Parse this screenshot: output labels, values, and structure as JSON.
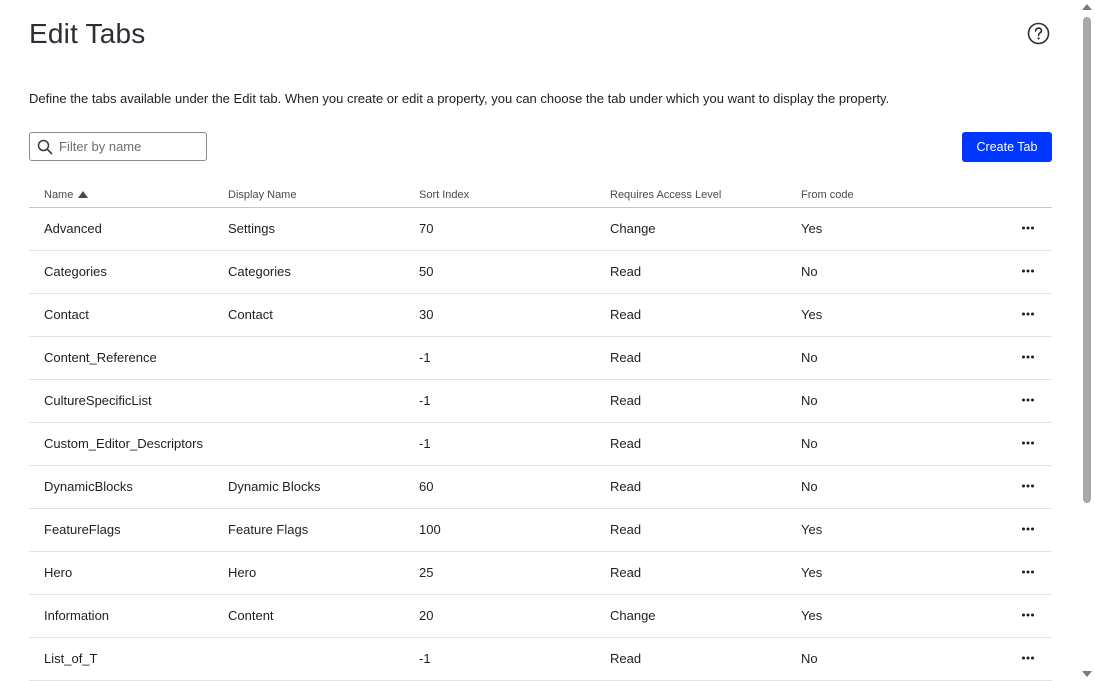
{
  "page": {
    "title": "Edit Tabs",
    "description": "Define the tabs available under the Edit tab. When you create or edit a property, you can choose the tab under which you want to display the property."
  },
  "icons": {
    "help": "help-circle-icon",
    "search": "search-icon",
    "sort": "sort-ascending-icon",
    "more": "more-horizontal-icon"
  },
  "colors": {
    "accent": "#0037ff",
    "text": "#1f1f1f"
  },
  "filter": {
    "placeholder": "Filter by name",
    "value": ""
  },
  "toolbar": {
    "create_label": "Create Tab"
  },
  "table": {
    "columns": [
      "Name",
      "Display Name",
      "Sort Index",
      "Requires Access Level",
      "From code"
    ],
    "sort_column": "Name",
    "sort_direction": "ascending",
    "rows": [
      {
        "name": "Advanced",
        "display_name": "Settings",
        "sort_index": "70",
        "access": "Change",
        "from_code": "Yes"
      },
      {
        "name": "Categories",
        "display_name": "Categories",
        "sort_index": "50",
        "access": "Read",
        "from_code": "No"
      },
      {
        "name": "Contact",
        "display_name": "Contact",
        "sort_index": "30",
        "access": "Read",
        "from_code": "Yes"
      },
      {
        "name": "Content_Reference",
        "display_name": "",
        "sort_index": "-1",
        "access": "Read",
        "from_code": "No"
      },
      {
        "name": "CultureSpecificList",
        "display_name": "",
        "sort_index": "-1",
        "access": "Read",
        "from_code": "No"
      },
      {
        "name": "Custom_Editor_Descriptors",
        "display_name": "",
        "sort_index": "-1",
        "access": "Read",
        "from_code": "No"
      },
      {
        "name": "DynamicBlocks",
        "display_name": "Dynamic Blocks",
        "sort_index": "60",
        "access": "Read",
        "from_code": "No"
      },
      {
        "name": "FeatureFlags",
        "display_name": "Feature Flags",
        "sort_index": "100",
        "access": "Read",
        "from_code": "Yes"
      },
      {
        "name": "Hero",
        "display_name": "Hero",
        "sort_index": "25",
        "access": "Read",
        "from_code": "Yes"
      },
      {
        "name": "Information",
        "display_name": "Content",
        "sort_index": "20",
        "access": "Change",
        "from_code": "Yes"
      },
      {
        "name": "List_of_T",
        "display_name": "",
        "sort_index": "-1",
        "access": "Read",
        "from_code": "No"
      }
    ]
  }
}
